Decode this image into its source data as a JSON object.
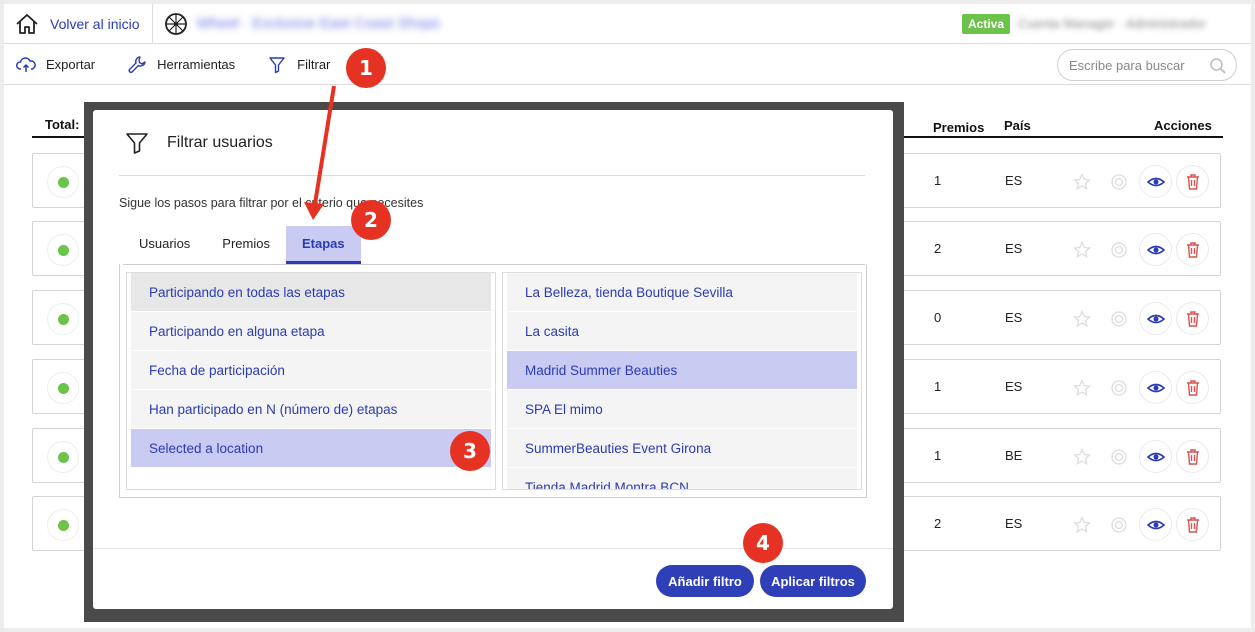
{
  "header": {
    "home_label": "Volver al inicio",
    "brand_name": "Wheel · Exclusive East Coast Shops",
    "status": "Activa",
    "user_info": "Cuenta Manager · Administrador"
  },
  "toolbar": {
    "export_label": "Exportar",
    "tools_label": "Herramientas",
    "filter_label": "Filtrar",
    "search_placeholder": "Escribe para buscar"
  },
  "table": {
    "total_label": "Total:",
    "columns": {
      "prizes": "Premios",
      "country": "País",
      "actions": "Acciones"
    },
    "rows": [
      {
        "prizes": "1",
        "country": "ES"
      },
      {
        "prizes": "2",
        "country": "ES"
      },
      {
        "prizes": "0",
        "country": "ES"
      },
      {
        "prizes": "1",
        "country": "ES"
      },
      {
        "prizes": "1",
        "country": "BE"
      },
      {
        "prizes": "2",
        "country": "ES"
      }
    ]
  },
  "modal": {
    "title": "Filtrar usuarios",
    "subtitle": "Sigue los pasos para filtrar por el criterio que necesites",
    "tabs": [
      "Usuarios",
      "Premios",
      "Etapas"
    ],
    "active_tab": "Etapas",
    "criteria": [
      "Participando en todas las etapas",
      "Participando en alguna etapa",
      "Fecha de participación",
      "Han participado en N (número de) etapas",
      "Selected a location"
    ],
    "locations": [
      "La Belleza, tienda Boutique Sevilla",
      "La casita",
      "Madrid Summer Beauties",
      "SPA El mimo",
      "SummerBeauties Event Girona",
      "Tienda Madrid Montra BCN"
    ],
    "add_filter_label": "Añadir filtro",
    "apply_filters_label": "Aplicar filtros"
  },
  "annotations": [
    "1",
    "2",
    "3",
    "4"
  ],
  "colors": {
    "accent": "#2f3fb8",
    "selected": "#c9cbf3",
    "active_badge": "#6cc24a",
    "annotation": "#e53222"
  }
}
